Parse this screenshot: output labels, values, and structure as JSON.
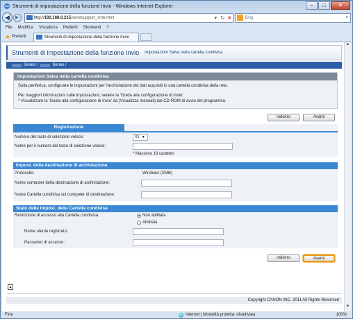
{
  "window": {
    "title": "Strumenti di impostazione della funzione Invio - Windows Internet Explorer",
    "buttons": {
      "minimize": "–",
      "maximize": "□",
      "close": "✕"
    }
  },
  "navigation": {
    "back_icon": "back-arrow-icon",
    "forward_icon": "forward-arrow-icon",
    "url_prefix": "http://",
    "url_domain": "192.168.0.215",
    "url_path": "/sendsupport_smb.html",
    "search_placeholder": "Bing",
    "search_icon_symbol": "⌕"
  },
  "menubar": [
    "File",
    "Modifica",
    "Visualizza",
    "Preferiti",
    "Strumenti",
    "?"
  ],
  "favorites": {
    "label": "Preferiti",
    "tab_title": "Strumenti di impostazione della funzione Invio"
  },
  "page": {
    "title": "Strumenti di impostazione della funzione Invio",
    "subtitle": "Impostazioni Salva nella cartella condivisa",
    "series": [
      "Series /",
      "Series /"
    ],
    "info": {
      "heading": "Impostazioni Salva nella cartella condivisa",
      "line1": "Sulla periferica, configurare le impostazioni per l'archiviazione dei dati acquisiti in una cartella condivisa della rete.",
      "line2": "Per maggiori informazioni sulle impostazioni, vedere la 'Guida alla configurazione di Invio'.",
      "line3": "* Visualizzare la 'Guida alla configurazione di Invio' da [Visualizza manuali] dal CD-ROM di avvio del programma."
    },
    "buttons": {
      "back": "Indietro",
      "next": "Avanti"
    },
    "registration": {
      "heading": "Registrazione",
      "speed_dial_label": "Numero del tasto di selezione veloce:",
      "speed_dial_value": "01",
      "name_label": "Nome per il numero del tasto di selezione veloce:",
      "name_value": "",
      "name_hint": "* Massimo 16 caratteri"
    },
    "destination": {
      "heading": "Impost. della destinazione di archiviazione",
      "protocol_label": "Protocollo:",
      "protocol_value": "Windows (SMB)",
      "computer_label": "Nome computer della destinazione di archiviazione:",
      "computer_value": "",
      "folder_label": "Nome Cartella condivisa sul computer di destinazione:",
      "folder_value": ""
    },
    "shared_folder": {
      "heading": "Stato delle impost. della Cartella condivisa",
      "restriction_label": "Restrizione di accesso alla Cartella condivisa:",
      "option_off": "Non abilitata",
      "option_on": "Abilitata",
      "user_label": "Nome utente registrato:",
      "password_label": "Password di accesso:"
    },
    "copyright": "Copyright CANON INC. 2011 All Rights Reserved"
  },
  "statusbar": {
    "left": "Fine",
    "zone": "Internet | Modalità protetta: disattivata",
    "zoom": "100%"
  }
}
